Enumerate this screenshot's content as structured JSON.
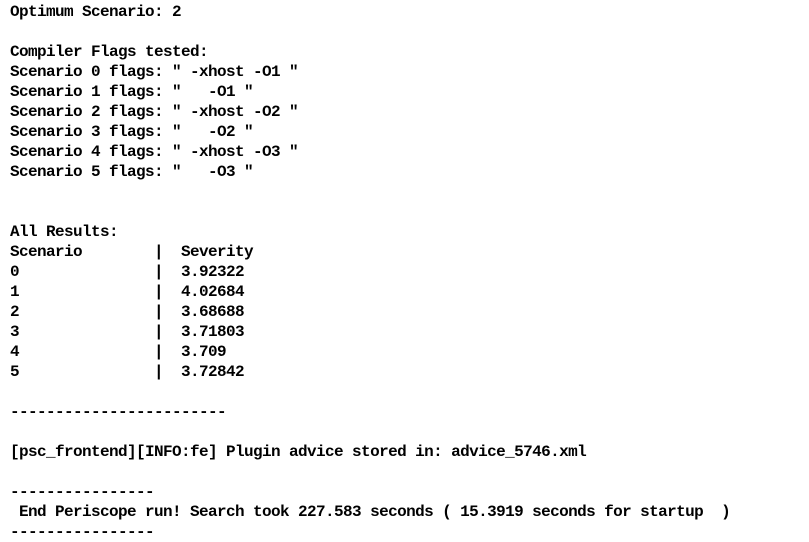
{
  "optimum_line": "Optimum Scenario: 2",
  "flags_header": "Compiler Flags tested:",
  "flags": [
    "Scenario 0 flags: \" -xhost -O1 \"",
    "Scenario 1 flags: \"   -O1 \"",
    "Scenario 2 flags: \" -xhost -O2 \"",
    "Scenario 3 flags: \"   -O2 \"",
    "Scenario 4 flags: \" -xhost -O3 \"",
    "Scenario 5 flags: \"   -O3 \""
  ],
  "results_header": "All Results:",
  "table_header": "Scenario        |  Severity",
  "results": [
    "0               |  3.92322",
    "1               |  4.02684",
    "2               |  3.68688",
    "3               |  3.71803",
    "4               |  3.709",
    "5               |  3.72842"
  ],
  "separator_long": "------------------------",
  "plugin_advice": "[psc_frontend][INFO:fe] Plugin advice stored in: advice_5746.xml",
  "separator_short_top": "----------------",
  "end_line": " End Periscope run! Search took 227.583 seconds ( 15.3919 seconds for startup  )",
  "separator_short_bottom": "----------------"
}
